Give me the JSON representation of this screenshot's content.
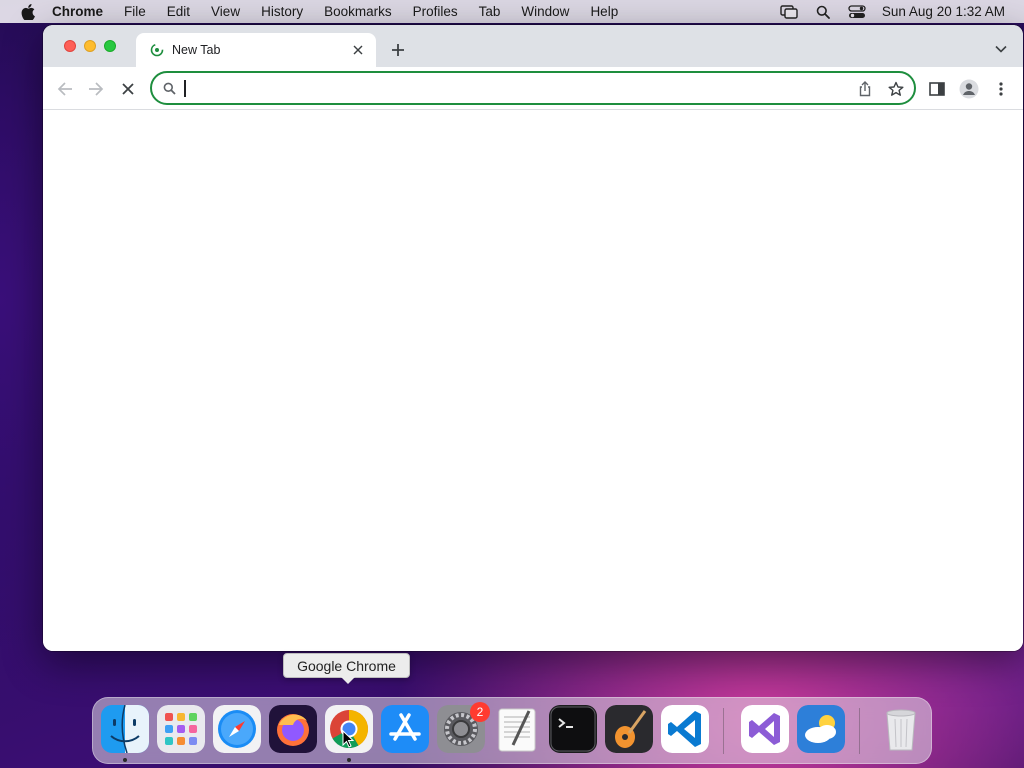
{
  "menubar": {
    "app_name": "Chrome",
    "items": [
      "File",
      "Edit",
      "View",
      "History",
      "Bookmarks",
      "Profiles",
      "Tab",
      "Window",
      "Help"
    ],
    "clock": "Sun Aug 20  1:32 AM",
    "status_icons": [
      "screen-mirroring-icon",
      "spotlight-search-icon",
      "control-center-icon"
    ]
  },
  "browser": {
    "tab": {
      "title": "New Tab",
      "favicon": "chrome-loading-icon"
    },
    "omnibox": {
      "value": "",
      "placeholder": ""
    },
    "accent_color": "#1e8e3e"
  },
  "tooltip": {
    "text": "Google Chrome"
  },
  "dock": {
    "apps": [
      {
        "name": "Finder",
        "icon": "finder-icon",
        "running": true
      },
      {
        "name": "Launchpad",
        "icon": "launchpad-icon",
        "running": false
      },
      {
        "name": "Safari",
        "icon": "safari-icon",
        "running": false
      },
      {
        "name": "Firefox",
        "icon": "firefox-icon",
        "running": false
      },
      {
        "name": "Google Chrome",
        "icon": "chrome-icon",
        "running": true
      },
      {
        "name": "App Store",
        "icon": "app-store-icon",
        "running": false
      },
      {
        "name": "System Preferences",
        "icon": "system-preferences-icon",
        "running": false,
        "badge": "2"
      },
      {
        "name": "TextEdit",
        "icon": "textedit-icon",
        "running": false
      },
      {
        "name": "Terminal",
        "icon": "terminal-icon",
        "running": false
      },
      {
        "name": "GarageBand",
        "icon": "garageband-icon",
        "running": false
      },
      {
        "name": "Visual Studio Code",
        "icon": "vscode-icon",
        "running": false
      },
      {
        "name": "Visual Studio",
        "icon": "visual-studio-icon",
        "running": false
      },
      {
        "name": "Weather",
        "icon": "weather-icon",
        "running": false
      },
      {
        "name": "Trash",
        "icon": "trash-icon",
        "running": false
      }
    ]
  }
}
